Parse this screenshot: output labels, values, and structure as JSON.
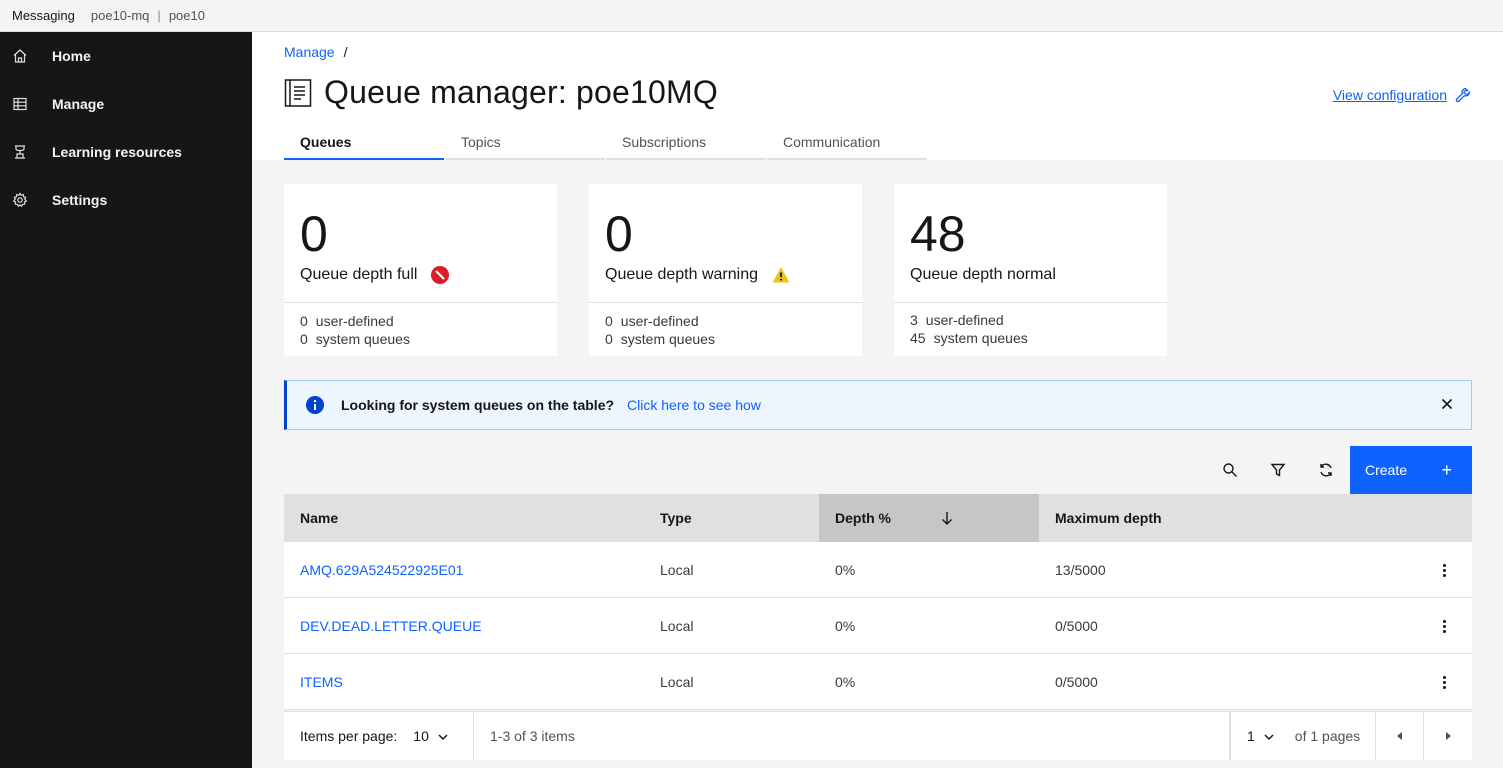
{
  "topbar": {
    "app": "Messaging",
    "crumb1": "poe10-mq",
    "separator": "|",
    "crumb2": "poe10"
  },
  "sidenav": {
    "items": [
      {
        "label": "Home",
        "icon": "home-icon"
      },
      {
        "label": "Manage",
        "icon": "table-icon"
      },
      {
        "label": "Learning resources",
        "icon": "learning-icon"
      },
      {
        "label": "Settings",
        "icon": "gear-icon"
      }
    ]
  },
  "header": {
    "breadcrumb_link": "Manage",
    "breadcrumb_sep": "/",
    "title": "Queue manager: poe10MQ",
    "view_config": "View configuration"
  },
  "tabs": [
    {
      "label": "Queues",
      "active": true
    },
    {
      "label": "Topics"
    },
    {
      "label": "Subscriptions"
    },
    {
      "label": "Communication"
    }
  ],
  "tiles": [
    {
      "value": "0",
      "label": "Queue depth full",
      "status_icon": "error-icon",
      "user": "0",
      "user_label": "user-defined",
      "system": "0",
      "system_label": "system queues"
    },
    {
      "value": "0",
      "label": "Queue depth warning",
      "status_icon": "warning-icon",
      "user": "0",
      "user_label": "user-defined",
      "system": "0",
      "system_label": "system queues"
    },
    {
      "value": "48",
      "label": "Queue depth normal",
      "user": "3",
      "user_label": "user-defined",
      "system": "45",
      "system_label": "system queues"
    }
  ],
  "notification": {
    "message": "Looking for system queues on the table?",
    "link": "Click here to see how"
  },
  "toolbar": {
    "create_label": "Create",
    "create_icon": "+"
  },
  "table": {
    "columns": [
      "Name",
      "Type",
      "Depth %",
      "Maximum depth"
    ],
    "rows": [
      {
        "name": "AMQ.629A524522925E01",
        "type": "Local",
        "depth": "0%",
        "max": "13/5000"
      },
      {
        "name": "DEV.DEAD.LETTER.QUEUE",
        "type": "Local",
        "depth": "0%",
        "max": "0/5000"
      },
      {
        "name": "ITEMS",
        "type": "Local",
        "depth": "0%",
        "max": "0/5000"
      }
    ]
  },
  "pagination": {
    "items_per_page_label": "Items per page:",
    "items_per_page": "10",
    "range": "1-3 of 3 items",
    "page": "1",
    "of_pages": "of 1 pages"
  }
}
